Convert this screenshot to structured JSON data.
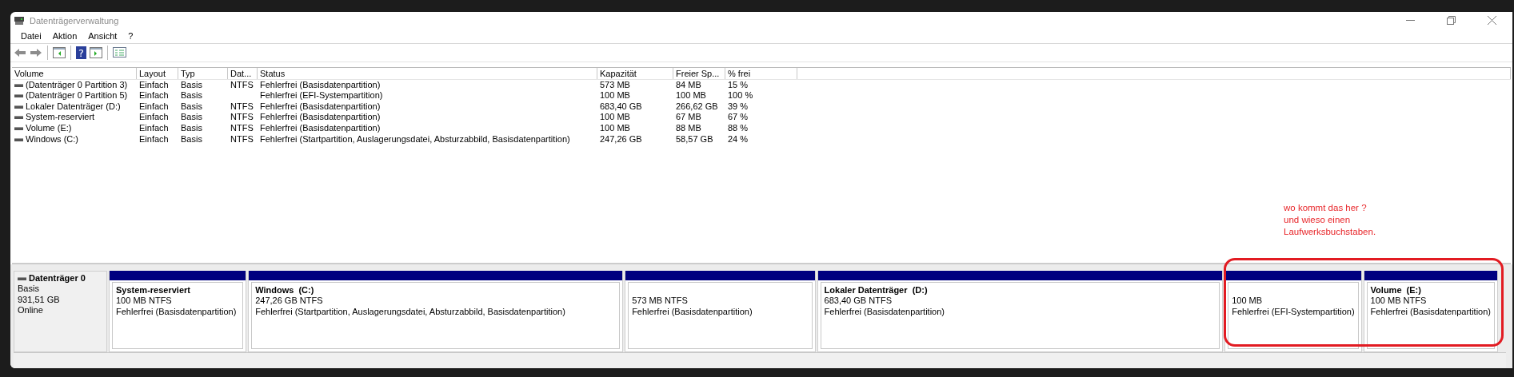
{
  "window": {
    "title": "Datenträgerverwaltung"
  },
  "menu": [
    "Datei",
    "Aktion",
    "Ansicht",
    "?"
  ],
  "toolbar": {
    "help_glyph": "?"
  },
  "table": {
    "columns": [
      "Volume",
      "Layout",
      "Typ",
      "Dat...",
      "Status",
      "Kapazität",
      "Freier Sp...",
      "% frei"
    ],
    "rows": [
      [
        "(Datenträger 0 Partition 3)",
        "Einfach",
        "Basis",
        "NTFS",
        "Fehlerfrei (Basisdatenpartition)",
        "573 MB",
        "84 MB",
        "15 %"
      ],
      [
        "(Datenträger 0 Partition 5)",
        "Einfach",
        "Basis",
        "",
        "Fehlerfrei (EFI-Systempartition)",
        "100 MB",
        "100 MB",
        "100 %"
      ],
      [
        "Lokaler Datenträger (D:)",
        "Einfach",
        "Basis",
        "NTFS",
        "Fehlerfrei (Basisdatenpartition)",
        "683,40 GB",
        "266,62 GB",
        "39 %"
      ],
      [
        "System-reserviert",
        "Einfach",
        "Basis",
        "NTFS",
        "Fehlerfrei (Basisdatenpartition)",
        "100 MB",
        "67 MB",
        "67 %"
      ],
      [
        "Volume (E:)",
        "Einfach",
        "Basis",
        "NTFS",
        "Fehlerfrei (Basisdatenpartition)",
        "100 MB",
        "88 MB",
        "88 %"
      ],
      [
        "Windows (C:)",
        "Einfach",
        "Basis",
        "NTFS",
        "Fehlerfrei (Startpartition, Auslagerungsdatei, Absturzabbild, Basisdatenpartition)",
        "247,26 GB",
        "58,57 GB",
        "24 %"
      ]
    ]
  },
  "disk": {
    "name": "Datenträger 0",
    "type": "Basis",
    "size": "931,51 GB",
    "state": "Online",
    "partitions": [
      {
        "title": "System-reserviert",
        "size": "100 MB NTFS",
        "status": "Fehlerfrei (Basisdatenpartition)"
      },
      {
        "title": "Windows  (C:)",
        "size": "247,26 GB NTFS",
        "status": "Fehlerfrei (Startpartition, Auslagerungsdatei, Absturzabbild, Basisdatenpartition)"
      },
      {
        "size": "573 MB NTFS",
        "status": "Fehlerfrei (Basisdatenpartition)"
      },
      {
        "title": "Lokaler Datenträger  (D:)",
        "size": "683,40 GB NTFS",
        "status": "Fehlerfrei (Basisdatenpartition)"
      },
      {
        "size": "100 MB",
        "status": "Fehlerfrei (EFI-Systempartition)"
      },
      {
        "title": "Volume  (E:)",
        "size": "100 MB NTFS",
        "status": "Fehlerfrei (Basisdatenpartition)"
      }
    ]
  },
  "annotation": {
    "lines": [
      "wo kommt das her ?",
      "und wieso einen",
      "Laufwerksbuchstaben."
    ]
  }
}
